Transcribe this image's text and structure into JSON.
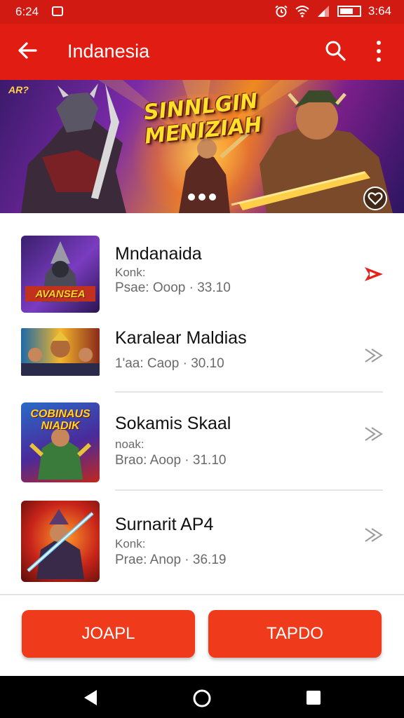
{
  "status_bar": {
    "time": "6:24",
    "clock_right": "3:64",
    "icons": [
      "notification-icon",
      "alarm-icon",
      "wifi-icon",
      "signal-icon",
      "battery-icon"
    ]
  },
  "app_bar": {
    "title": "Indanesia",
    "back_icon": "arrow-left-icon",
    "search_icon": "search-icon",
    "menu_icon": "more-vert-icon"
  },
  "banner": {
    "headline_line1": "SINNLGIN",
    "headline_line2": "MENIZIAH",
    "corner_tag": "AR?",
    "carousel_dots": 3,
    "active_dot": 0,
    "favorite_icon": "heart-icon"
  },
  "games": [
    {
      "title": "Mndanaida",
      "line1": "Konk:",
      "line2": "Psae: Ooop · 33.10",
      "thumb_text": "AVANSEA",
      "arrow": "red-play-arrow-icon"
    },
    {
      "title": "Karalear Maldias",
      "line1": "",
      "line2": "1'aa: Caop · 30.10",
      "thumb_text": "",
      "arrow": "double-chevron-right-icon"
    },
    {
      "title": "Sokamis Skaal",
      "line1": "noak:",
      "line2": "Brao: Aoop · 31.10",
      "thumb_text": "COBINAUS NIADIK",
      "arrow": "double-chevron-right-icon"
    },
    {
      "title": "Surnarit AP4",
      "line1": "Konk:",
      "line2": "Prae: Anop · 36.19",
      "thumb_text": "",
      "arrow": "double-chevron-right-icon"
    }
  ],
  "buttons": {
    "left": "JOAPL",
    "right": "TAPDO"
  },
  "nav_bar": {
    "back": "nav-back-icon",
    "home": "nav-home-icon",
    "recents": "nav-recents-icon"
  },
  "colors": {
    "primary": "#e11d13",
    "status": "#d11a12",
    "button": "#ef3a1b"
  }
}
